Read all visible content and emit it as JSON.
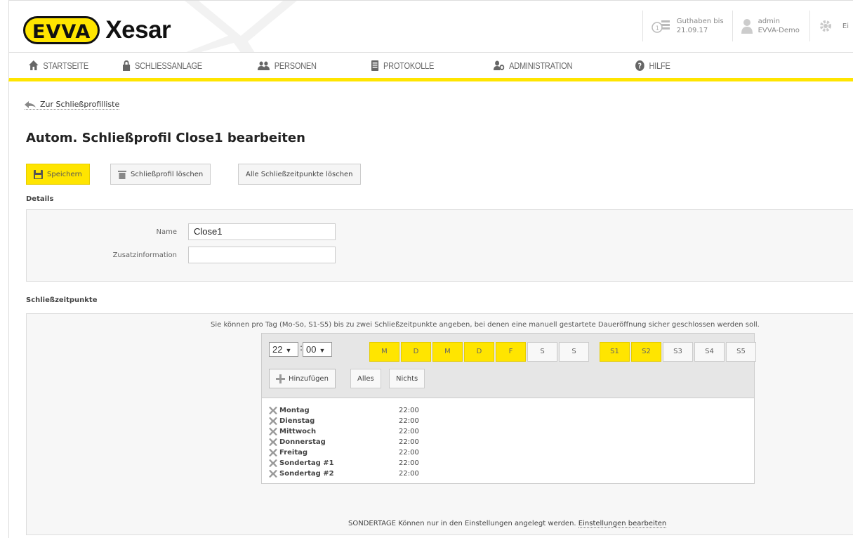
{
  "header": {
    "logo_badge": "EVVA",
    "logo_text": "Xesar",
    "credit_label": "Guthaben bis",
    "credit_date": "21.09.17",
    "user_name": "admin",
    "user_org": "EVVA-Demo",
    "cut_text": "Ei",
    "accent_color": "#ffe500"
  },
  "nav": [
    {
      "label": "STARTSEITE",
      "icon": "home-icon"
    },
    {
      "label": "SCHLIESSANLAGE",
      "icon": "lock-icon"
    },
    {
      "label": "PERSONEN",
      "icon": "people-icon"
    },
    {
      "label": "PROTOKOLLE",
      "icon": "document-icon"
    },
    {
      "label": "ADMINISTRATION",
      "icon": "admin-icon"
    },
    {
      "label": "HILFE",
      "icon": "help-icon"
    }
  ],
  "page": {
    "back_link": "Zur Schließprofilliste",
    "title": "Autom. Schließprofil Close1 bearbeiten",
    "buttons": {
      "save": "Speichern",
      "delete_profile": "Schließprofil löschen",
      "delete_all": "Alle Schließzeitpunkte löschen"
    }
  },
  "details": {
    "section": "Details",
    "name_label": "Name",
    "name_value": "Close1",
    "extra_label": "Zusatzinformation",
    "extra_value": ""
  },
  "schedule": {
    "section": "Schließzeitpunkte",
    "hint": "Sie können pro Tag (Mo-So, S1-S5) bis zu zwei Schließzeitpunkte angeben, bei denen eine manuell gestartete Daueröffnung sicher geschlossen werden soll.",
    "hour": "22",
    "minute": "00",
    "days": [
      {
        "label": "M",
        "selected": true
      },
      {
        "label": "D",
        "selected": true
      },
      {
        "label": "M",
        "selected": true
      },
      {
        "label": "D",
        "selected": true
      },
      {
        "label": "F",
        "selected": true
      },
      {
        "label": "S",
        "selected": false
      },
      {
        "label": "S",
        "selected": false
      }
    ],
    "special_days": [
      {
        "label": "S1",
        "selected": true
      },
      {
        "label": "S2",
        "selected": true
      },
      {
        "label": "S3",
        "selected": false
      },
      {
        "label": "S4",
        "selected": false
      },
      {
        "label": "S5",
        "selected": false
      }
    ],
    "add_button": "Hinzufügen",
    "all_button": "Alles",
    "none_button": "Nichts",
    "entries": [
      {
        "day": "Montag",
        "time": "22:00"
      },
      {
        "day": "Dienstag",
        "time": "22:00"
      },
      {
        "day": "Mittwoch",
        "time": "22:00"
      },
      {
        "day": "Donnerstag",
        "time": "22:00"
      },
      {
        "day": "Freitag",
        "time": "22:00"
      },
      {
        "day": "Sondertag #1",
        "time": "22:00"
      },
      {
        "day": "Sondertag #2",
        "time": "22:00"
      }
    ],
    "footer_label": "SONDERTAGE",
    "footer_text": "Können nur in den Einstellungen angelegt werden.",
    "footer_link": "Einstellungen bearbeiten"
  }
}
